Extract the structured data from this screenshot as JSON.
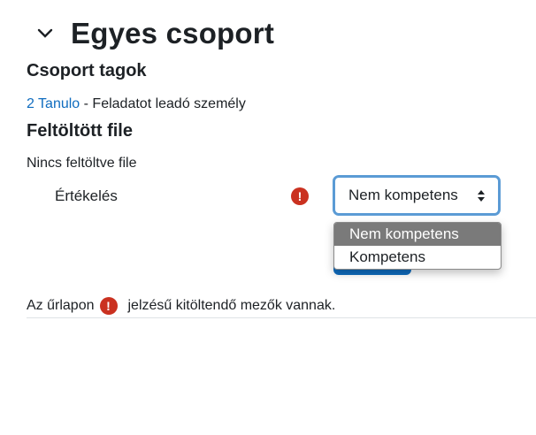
{
  "section": {
    "title": "Egyes csoport"
  },
  "group": {
    "heading": "Csoport tagok",
    "member_link": "2 Tanulo",
    "member_desc": " - Feladatot leadó személy"
  },
  "files": {
    "heading": "Feltöltött file",
    "status": "Nincs feltöltve file"
  },
  "grade": {
    "label": "Értékelés",
    "required_icon": "!",
    "selected": "Nem kompetens",
    "options": [
      "Nem kompetens",
      "Kompetens"
    ]
  },
  "form_note": {
    "before": "Az űrlapon",
    "after": "jelzésű kitöltendő mezők vannak."
  },
  "colors": {
    "required": "#ca3120",
    "link": "#0f6cbf",
    "focus": "#5b9bd5"
  }
}
